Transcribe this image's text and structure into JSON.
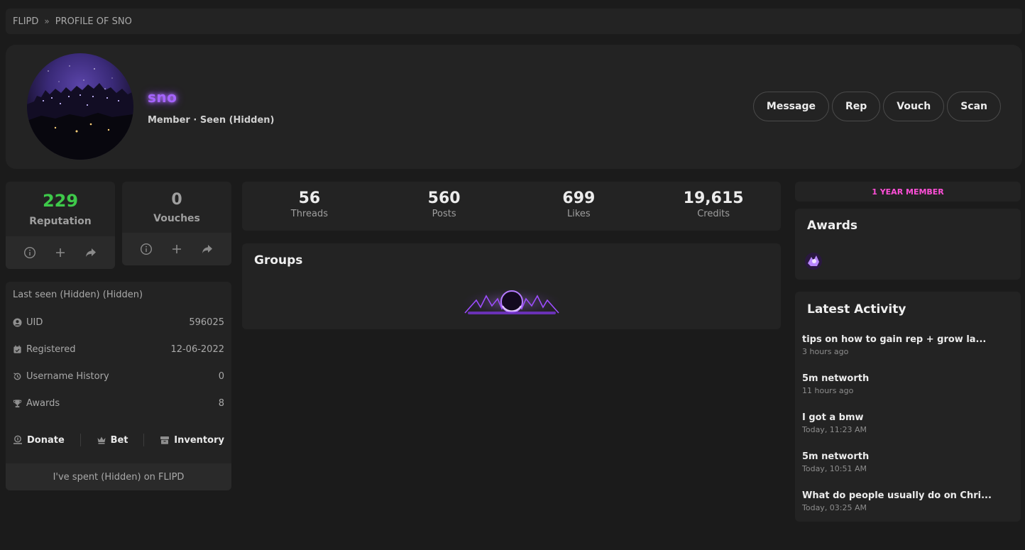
{
  "breadcrumb": {
    "home": "FLIPD",
    "current": "PROFILE OF SNO"
  },
  "profile": {
    "username": "sno",
    "subline": "Member · Seen (Hidden)",
    "actions": [
      "Message",
      "Rep",
      "Vouch",
      "Scan"
    ]
  },
  "reputation": {
    "value": "229",
    "label": "Reputation",
    "color": "#3ec94a"
  },
  "vouches": {
    "value": "0",
    "label": "Vouches"
  },
  "info": {
    "last_seen": "Last seen (Hidden) (Hidden)",
    "rows": [
      {
        "icon": "user-circle-icon",
        "label": "UID",
        "value": "596025"
      },
      {
        "icon": "calendar-icon",
        "label": "Registered",
        "value": "12-06-2022"
      },
      {
        "icon": "history-icon",
        "label": "Username History",
        "value": "0"
      },
      {
        "icon": "trophy-icon",
        "label": "Awards",
        "value": "8"
      }
    ],
    "links": [
      "Donate",
      "Bet",
      "Inventory"
    ],
    "spent": "I've spent (Hidden) on FLIPD"
  },
  "counters": [
    {
      "value": "56",
      "label": "Threads"
    },
    {
      "value": "560",
      "label": "Posts"
    },
    {
      "value": "699",
      "label": "Likes"
    },
    {
      "value": "19,615",
      "label": "Credits"
    }
  ],
  "groups": {
    "title": "Groups"
  },
  "membership": "1 YEAR MEMBER",
  "awards": {
    "title": "Awards"
  },
  "activity": {
    "title": "Latest Activity",
    "items": [
      {
        "title": "tips on how to gain rep + grow la...",
        "time": "3 hours ago"
      },
      {
        "title": "5m networth",
        "time": "11 hours ago"
      },
      {
        "title": "I got a bmw",
        "time": "Today, 11:23 AM"
      },
      {
        "title": "5m networth",
        "time": "Today, 10:51 AM"
      },
      {
        "title": "What do people usually do on Chri...",
        "time": "Today, 03:25 AM"
      }
    ]
  },
  "colors": {
    "accent_purple": "#a564ff",
    "membership_pink": "#ff4fd8",
    "background": "#1b1b1b",
    "card": "#232323"
  }
}
